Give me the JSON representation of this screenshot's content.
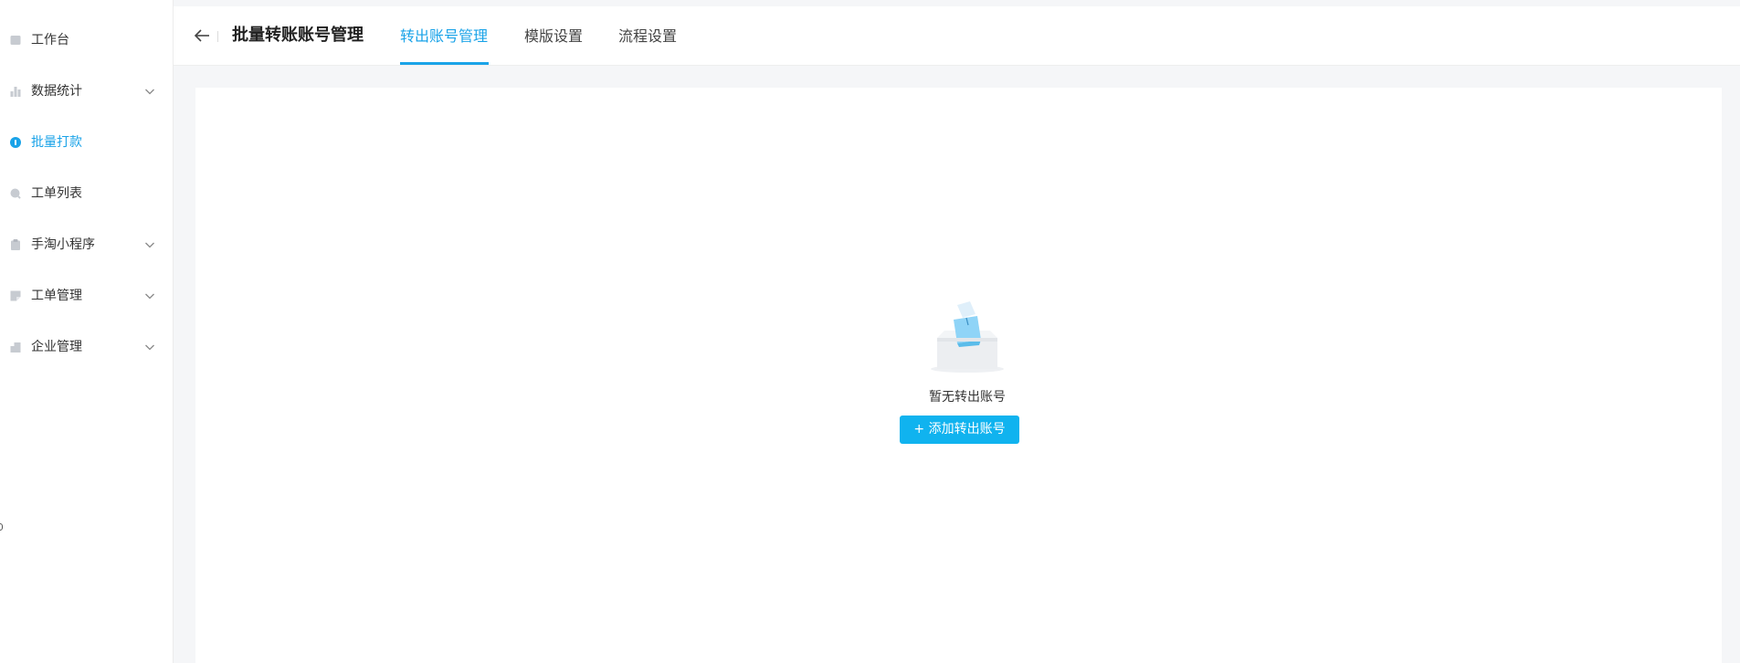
{
  "colors": {
    "accent": "#1aa3e8",
    "button_bg": "#10b3ef",
    "icon_gray": "#c7cbd1"
  },
  "sidebar": {
    "items": [
      {
        "label": "工作台",
        "icon": "workbench-icon",
        "has_submenu": false,
        "active": false
      },
      {
        "label": "数据统计",
        "icon": "bar-chart-icon",
        "has_submenu": true,
        "active": false
      },
      {
        "label": "批量打款",
        "icon": "coin-icon",
        "has_submenu": false,
        "active": true
      },
      {
        "label": "工单列表",
        "icon": "search-icon",
        "has_submenu": false,
        "active": false
      },
      {
        "label": "手淘小程序",
        "icon": "clipboard-icon",
        "has_submenu": true,
        "active": false
      },
      {
        "label": "工单管理",
        "icon": "ticket-icon",
        "has_submenu": true,
        "active": false
      },
      {
        "label": "企业管理",
        "icon": "building-icon",
        "has_submenu": true,
        "active": false
      }
    ]
  },
  "header": {
    "back_icon": "back-arrow-icon",
    "title": "批量转账账号管理",
    "tabs": [
      {
        "label": "转出账号管理",
        "active": true
      },
      {
        "label": "模版设置",
        "active": false
      },
      {
        "label": "流程设置",
        "active": false
      }
    ]
  },
  "main": {
    "empty_icon": "empty-box-icon",
    "empty_text": "暂无转出账号",
    "add_button_label": "+ 添加转出账号"
  }
}
